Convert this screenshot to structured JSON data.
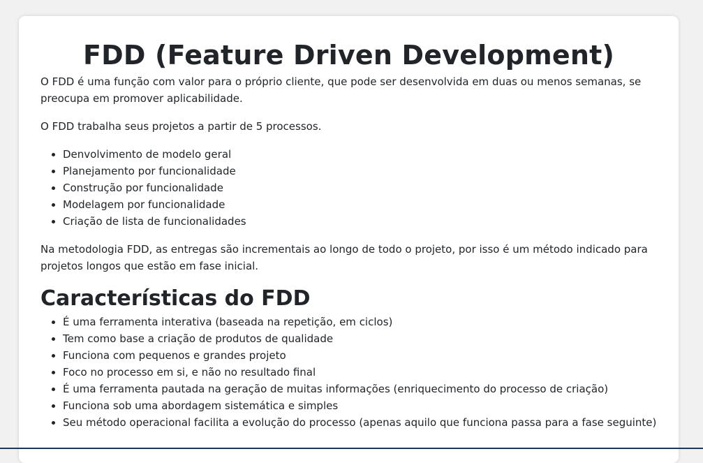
{
  "title": "FDD (Feature Driven Development)",
  "intro": "O FDD é uma função com valor para o próprio cliente, que pode ser desenvolvida em duas ou menos semanas, se preocupa em promover aplicabilidade.",
  "processes_intro": "O FDD trabalha seus projetos a partir de 5 processos.",
  "processes": [
    "Denvolvimento de modelo geral",
    "Planejamento por funcionalidade",
    "Construção por funcionalidade",
    "Modelagem por funcionalidade",
    "Criação de lista de funcionalidades"
  ],
  "methodology_text": "Na metodologia FDD, as entregas são incrementais ao longo de todo o projeto, por isso é um método indicado para projetos longos que estão em fase inicial.",
  "characteristics_heading": "Características do FDD",
  "characteristics": [
    "É uma ferramenta interativa (baseada na repetição, em ciclos)",
    "Tem como base a criação de produtos de qualidade",
    "Funciona com pequenos e grandes projeto",
    "Foco no processo em si, e não no resultado final",
    "É uma ferramenta pautada na geração de muitas informações (enriquecimento do processo de criação)",
    "Funciona sob uma abordagem sistemática e simples",
    "Seu método operacional facilita a evolução do processo (apenas aquilo que funciona passa para a fase seguinte)"
  ]
}
